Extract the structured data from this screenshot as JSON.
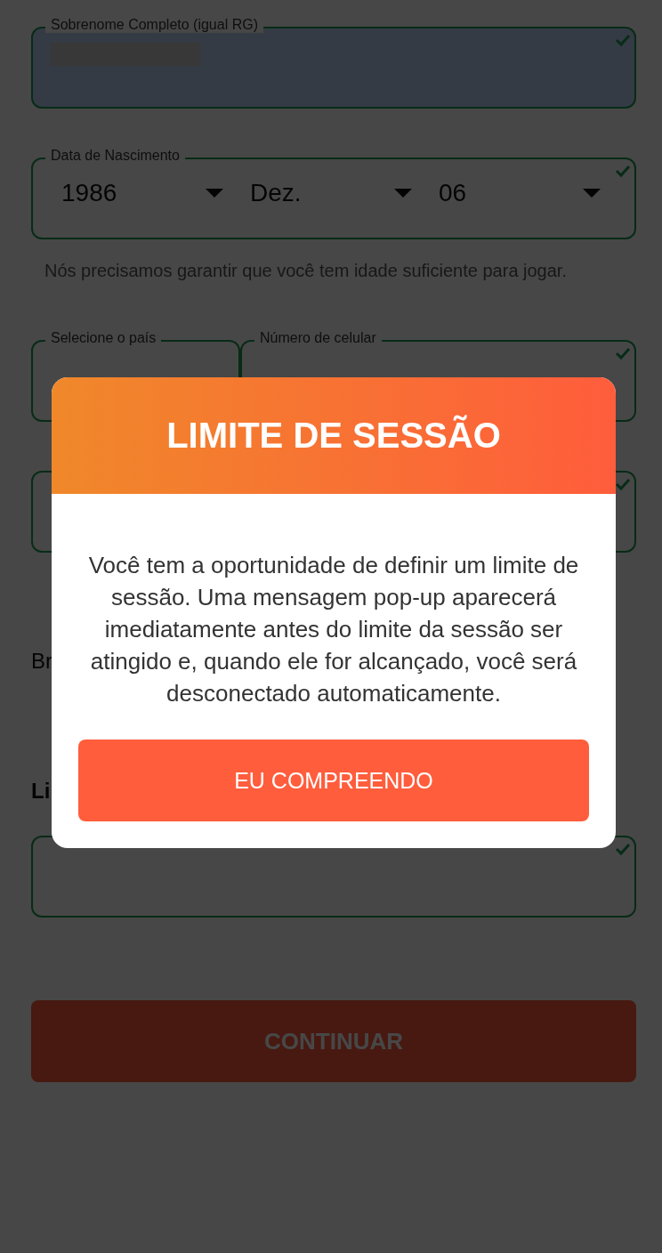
{
  "form": {
    "items": [
      {
        "kind": "field",
        "label": "Sobrenome Completo (igual RG)",
        "value_redacted": true,
        "autofilled": true,
        "valid": true
      },
      {
        "kind": "date",
        "label": "Data de Nascimento",
        "selects": [
          "1986",
          "Dez.",
          "06"
        ],
        "valid": true
      },
      {
        "kind": "helper",
        "text": "Nós precisamos garantir que você tem idade suficiente para jogar."
      },
      {
        "kind": "pair",
        "fields": [
          {
            "label": "Selecione o país",
            "valid": false
          },
          {
            "label": "Número de celular",
            "valid": true
          }
        ]
      },
      {
        "kind": "field",
        "valid": true
      },
      {
        "kind": "text",
        "text": "Br"
      },
      {
        "kind": "heading",
        "text": "Li"
      },
      {
        "kind": "field",
        "valid": true
      }
    ],
    "submit": {
      "label": "CONTINUAR"
    }
  },
  "modal": {
    "title": "LIMITE DE SESSÃO",
    "message": "Você tem a oportunidade de definir um limite de sessão. Uma mensagem pop-up aparecerá imediatamente antes do limite da sessão ser atingido e, quando ele for alcançado, você será desconectado automaticamente.",
    "button": "EU COMPREENDO"
  }
}
